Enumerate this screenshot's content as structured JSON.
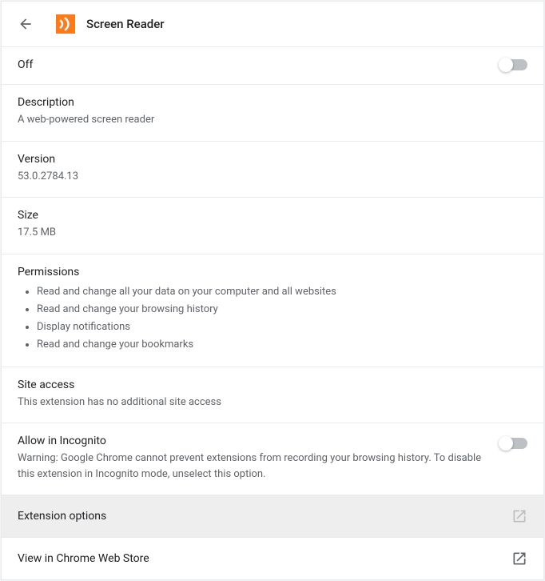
{
  "header": {
    "title": "Screen Reader"
  },
  "sections": {
    "state_label": "Off",
    "description_label": "Description",
    "description_value": "A web-powered screen reader",
    "version_label": "Version",
    "version_value": "53.0.2784.13",
    "size_label": "Size",
    "size_value": "17.5 MB",
    "permissions_label": "Permissions",
    "permissions": [
      "Read and change all your data on your computer and all websites",
      "Read and change your browsing history",
      "Display notifications",
      "Read and change your bookmarks"
    ],
    "site_access_label": "Site access",
    "site_access_value": "This extension has no additional site access",
    "incognito_label": "Allow in Incognito",
    "incognito_warning": "Warning: Google Chrome cannot prevent extensions from recording your browsing history. To disable this extension in Incognito mode, unselect this option.",
    "ext_options_label": "Extension options",
    "webstore_label": "View in Chrome Web Store"
  }
}
